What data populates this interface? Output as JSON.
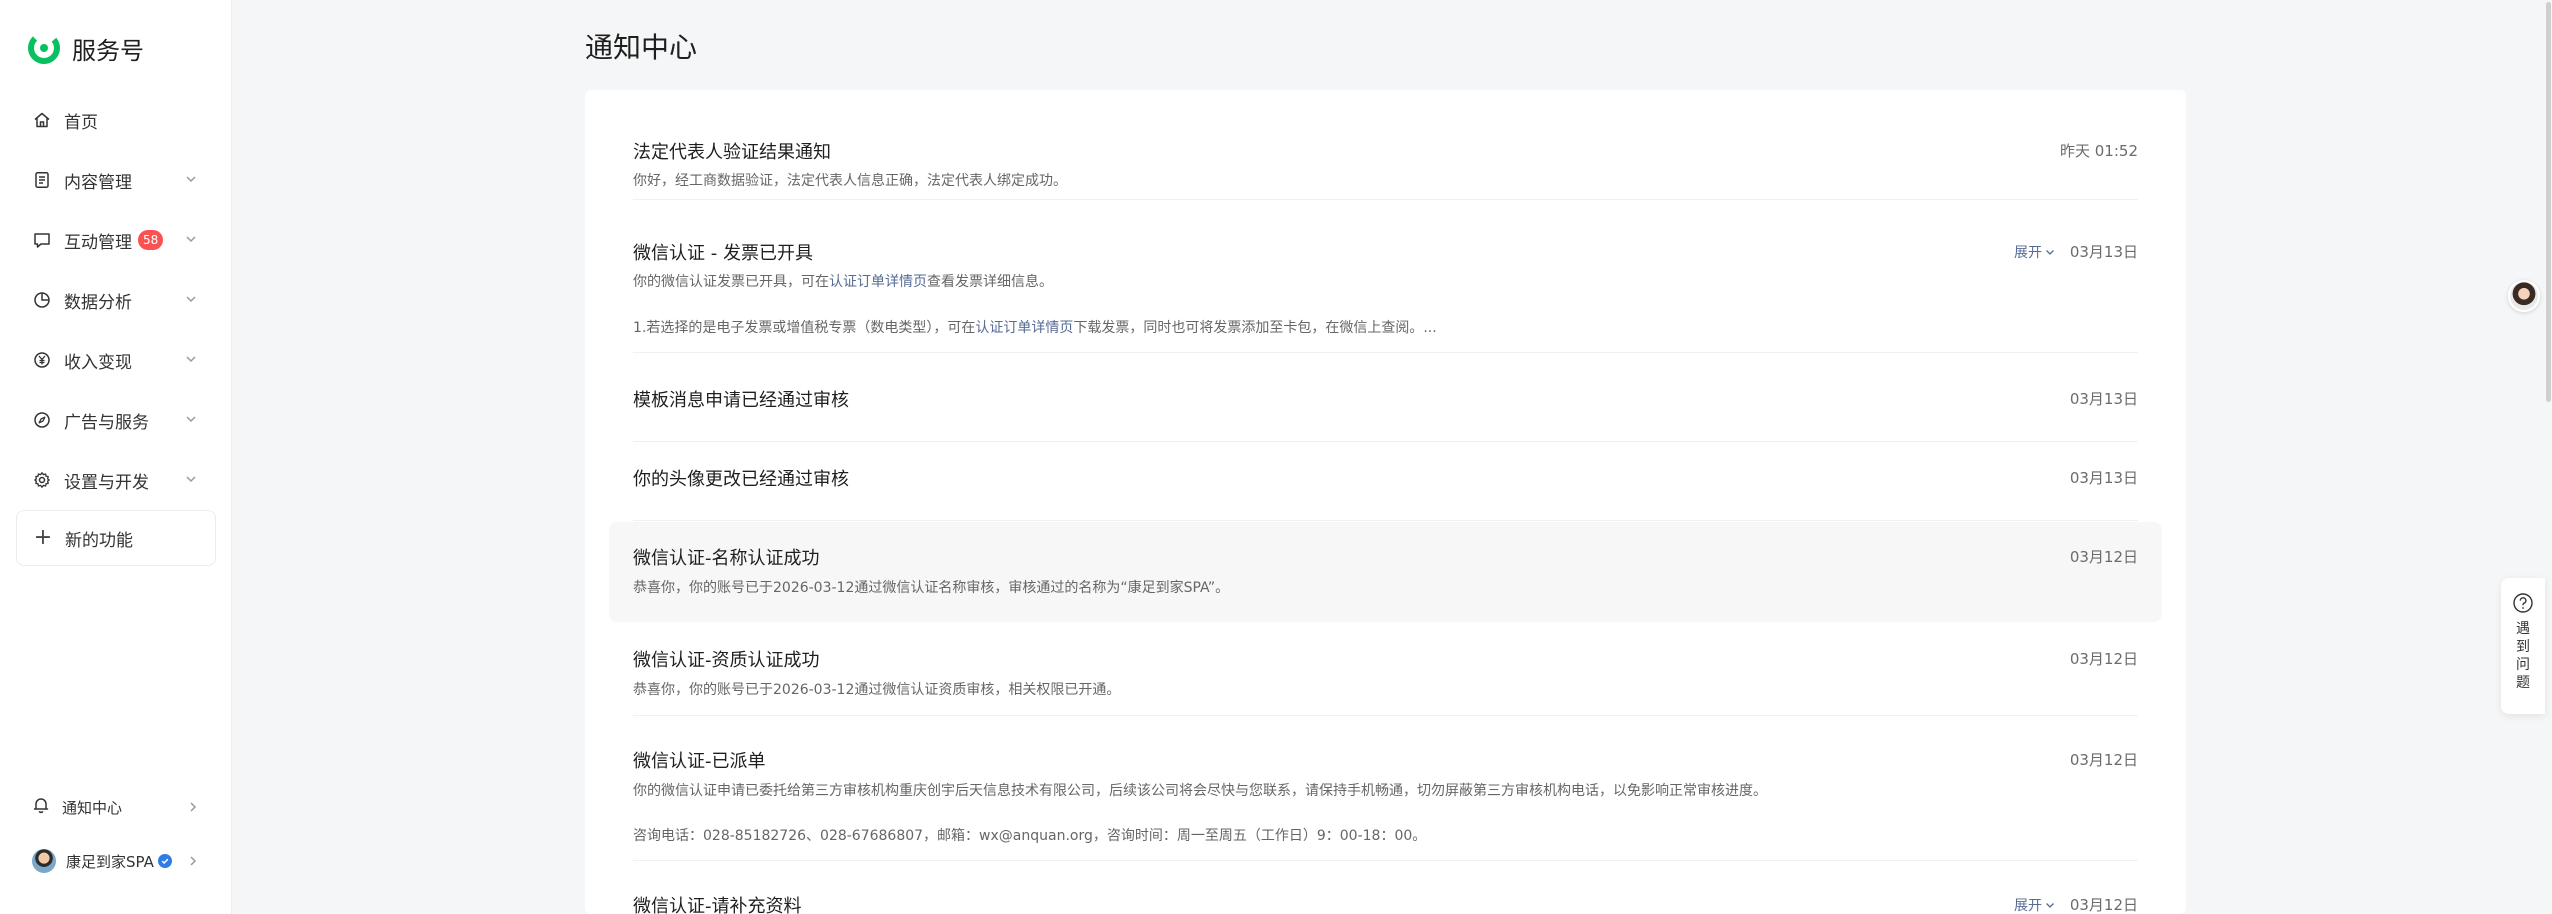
{
  "brand": {
    "name": "服务号",
    "color": "#07c160"
  },
  "sidebar": {
    "items": [
      {
        "label": "首页",
        "icon": "home-icon",
        "has_arrow": false
      },
      {
        "label": "内容管理",
        "icon": "document-icon",
        "has_arrow": true
      },
      {
        "label": "互动管理",
        "icon": "chat-icon",
        "has_arrow": true,
        "badge": "58"
      },
      {
        "label": "数据分析",
        "icon": "pie-chart-icon",
        "has_arrow": true
      },
      {
        "label": "收入变现",
        "icon": "yuan-icon",
        "has_arrow": true
      },
      {
        "label": "广告与服务",
        "icon": "compass-icon",
        "has_arrow": true
      },
      {
        "label": "设置与开发",
        "icon": "gear-icon",
        "has_arrow": true
      }
    ],
    "new_feature": "新的功能",
    "notification_center": "通知中心",
    "account_name": "康足到家SPA"
  },
  "page": {
    "title": "通知中心"
  },
  "notices": [
    {
      "title": "法定代表人验证结果通知",
      "time": "昨天 01:52",
      "desc": "你好，经工商数据验证，法定代表人信息正确，法定代表人绑定成功。"
    },
    {
      "title": "微信认证 - 发票已开具",
      "time": "03月13日",
      "expand": "展开",
      "desc_pre": "你的微信认证发票已开具，可在",
      "desc_link": "认证订单详情页",
      "desc_post": "查看发票详细信息。",
      "desc2_pre": "1.若选择的是电子发票或增值税专票（数电类型），可在",
      "desc2_link": "认证订单详情页",
      "desc2_post": "下载发票，同时也可将发票添加至卡包，在微信上查阅。..."
    },
    {
      "title": "模板消息申请已经通过审核",
      "time": "03月13日"
    },
    {
      "title": "你的头像更改已经通过审核",
      "time": "03月13日"
    },
    {
      "title": "微信认证-名称认证成功",
      "time": "03月12日",
      "desc": "恭喜你，你的账号已于2026-03-12通过微信认证名称审核，审核通过的名称为“康足到家SPA”。"
    },
    {
      "title": "微信认证-资质认证成功",
      "time": "03月12日",
      "desc": "恭喜你，你的账号已于2026-03-12通过微信认证资质审核，相关权限已开通。"
    },
    {
      "title": "微信认证-已派单",
      "time": "03月12日",
      "desc": "你的微信认证申请已委托给第三方审核机构重庆创宇后天信息技术有限公司，后续该公司将会尽快与您联系，请保持手机畅通，切勿屏蔽第三方审核机构电话，以免影响正常审核进度。",
      "desc2": "咨询电话：028-85182726、028-67686807，邮箱：wx@anquan.org，咨询时间：周一至周五（工作日）9：00-18：00。"
    },
    {
      "title": "微信认证-请补充资料",
      "time": "03月12日",
      "expand": "展开"
    }
  ],
  "help": {
    "label": "遇到问题"
  },
  "colors": {
    "accent": "#07c160",
    "link": "#576b95",
    "badge": "#fa5151"
  }
}
